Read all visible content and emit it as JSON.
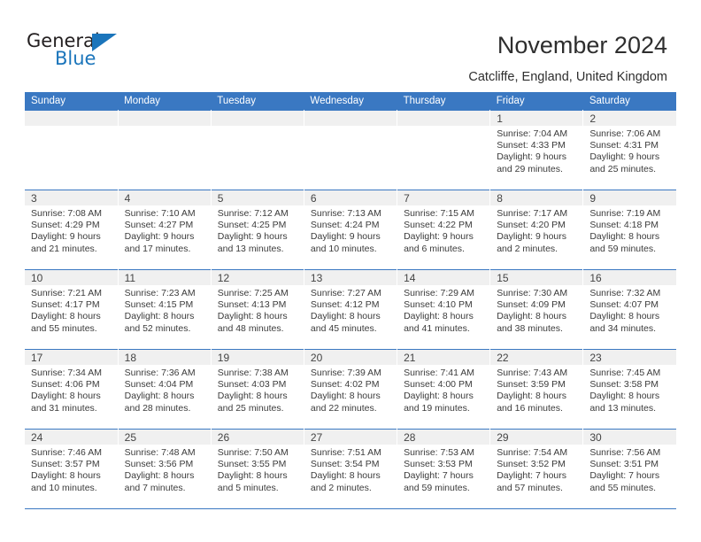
{
  "brand": {
    "name_top": "General",
    "name_bottom": "Blue",
    "accent_color": "#1b75bb"
  },
  "header": {
    "title": "November 2024",
    "subtitle": "Catcliffe, England, United Kingdom"
  },
  "theme": {
    "header_blue": "#3a78c2",
    "daynum_background": "#f0f0f0",
    "text_color": "#3b3b3b"
  },
  "calendar": {
    "weekday_headers": [
      "Sunday",
      "Monday",
      "Tuesday",
      "Wednesday",
      "Thursday",
      "Friday",
      "Saturday"
    ],
    "weeks": [
      [
        {
          "day": "",
          "empty": true
        },
        {
          "day": "",
          "empty": true
        },
        {
          "day": "",
          "empty": true
        },
        {
          "day": "",
          "empty": true
        },
        {
          "day": "",
          "empty": true
        },
        {
          "day": "1",
          "sunrise": "Sunrise: 7:04 AM",
          "sunset": "Sunset: 4:33 PM",
          "daylight_line1": "Daylight: 9 hours",
          "daylight_line2": "and 29 minutes."
        },
        {
          "day": "2",
          "sunrise": "Sunrise: 7:06 AM",
          "sunset": "Sunset: 4:31 PM",
          "daylight_line1": "Daylight: 9 hours",
          "daylight_line2": "and 25 minutes."
        }
      ],
      [
        {
          "day": "3",
          "sunrise": "Sunrise: 7:08 AM",
          "sunset": "Sunset: 4:29 PM",
          "daylight_line1": "Daylight: 9 hours",
          "daylight_line2": "and 21 minutes."
        },
        {
          "day": "4",
          "sunrise": "Sunrise: 7:10 AM",
          "sunset": "Sunset: 4:27 PM",
          "daylight_line1": "Daylight: 9 hours",
          "daylight_line2": "and 17 minutes."
        },
        {
          "day": "5",
          "sunrise": "Sunrise: 7:12 AM",
          "sunset": "Sunset: 4:25 PM",
          "daylight_line1": "Daylight: 9 hours",
          "daylight_line2": "and 13 minutes."
        },
        {
          "day": "6",
          "sunrise": "Sunrise: 7:13 AM",
          "sunset": "Sunset: 4:24 PM",
          "daylight_line1": "Daylight: 9 hours",
          "daylight_line2": "and 10 minutes."
        },
        {
          "day": "7",
          "sunrise": "Sunrise: 7:15 AM",
          "sunset": "Sunset: 4:22 PM",
          "daylight_line1": "Daylight: 9 hours",
          "daylight_line2": "and 6 minutes."
        },
        {
          "day": "8",
          "sunrise": "Sunrise: 7:17 AM",
          "sunset": "Sunset: 4:20 PM",
          "daylight_line1": "Daylight: 9 hours",
          "daylight_line2": "and 2 minutes."
        },
        {
          "day": "9",
          "sunrise": "Sunrise: 7:19 AM",
          "sunset": "Sunset: 4:18 PM",
          "daylight_line1": "Daylight: 8 hours",
          "daylight_line2": "and 59 minutes."
        }
      ],
      [
        {
          "day": "10",
          "sunrise": "Sunrise: 7:21 AM",
          "sunset": "Sunset: 4:17 PM",
          "daylight_line1": "Daylight: 8 hours",
          "daylight_line2": "and 55 minutes."
        },
        {
          "day": "11",
          "sunrise": "Sunrise: 7:23 AM",
          "sunset": "Sunset: 4:15 PM",
          "daylight_line1": "Daylight: 8 hours",
          "daylight_line2": "and 52 minutes."
        },
        {
          "day": "12",
          "sunrise": "Sunrise: 7:25 AM",
          "sunset": "Sunset: 4:13 PM",
          "daylight_line1": "Daylight: 8 hours",
          "daylight_line2": "and 48 minutes."
        },
        {
          "day": "13",
          "sunrise": "Sunrise: 7:27 AM",
          "sunset": "Sunset: 4:12 PM",
          "daylight_line1": "Daylight: 8 hours",
          "daylight_line2": "and 45 minutes."
        },
        {
          "day": "14",
          "sunrise": "Sunrise: 7:29 AM",
          "sunset": "Sunset: 4:10 PM",
          "daylight_line1": "Daylight: 8 hours",
          "daylight_line2": "and 41 minutes."
        },
        {
          "day": "15",
          "sunrise": "Sunrise: 7:30 AM",
          "sunset": "Sunset: 4:09 PM",
          "daylight_line1": "Daylight: 8 hours",
          "daylight_line2": "and 38 minutes."
        },
        {
          "day": "16",
          "sunrise": "Sunrise: 7:32 AM",
          "sunset": "Sunset: 4:07 PM",
          "daylight_line1": "Daylight: 8 hours",
          "daylight_line2": "and 34 minutes."
        }
      ],
      [
        {
          "day": "17",
          "sunrise": "Sunrise: 7:34 AM",
          "sunset": "Sunset: 4:06 PM",
          "daylight_line1": "Daylight: 8 hours",
          "daylight_line2": "and 31 minutes."
        },
        {
          "day": "18",
          "sunrise": "Sunrise: 7:36 AM",
          "sunset": "Sunset: 4:04 PM",
          "daylight_line1": "Daylight: 8 hours",
          "daylight_line2": "and 28 minutes."
        },
        {
          "day": "19",
          "sunrise": "Sunrise: 7:38 AM",
          "sunset": "Sunset: 4:03 PM",
          "daylight_line1": "Daylight: 8 hours",
          "daylight_line2": "and 25 minutes."
        },
        {
          "day": "20",
          "sunrise": "Sunrise: 7:39 AM",
          "sunset": "Sunset: 4:02 PM",
          "daylight_line1": "Daylight: 8 hours",
          "daylight_line2": "and 22 minutes."
        },
        {
          "day": "21",
          "sunrise": "Sunrise: 7:41 AM",
          "sunset": "Sunset: 4:00 PM",
          "daylight_line1": "Daylight: 8 hours",
          "daylight_line2": "and 19 minutes."
        },
        {
          "day": "22",
          "sunrise": "Sunrise: 7:43 AM",
          "sunset": "Sunset: 3:59 PM",
          "daylight_line1": "Daylight: 8 hours",
          "daylight_line2": "and 16 minutes."
        },
        {
          "day": "23",
          "sunrise": "Sunrise: 7:45 AM",
          "sunset": "Sunset: 3:58 PM",
          "daylight_line1": "Daylight: 8 hours",
          "daylight_line2": "and 13 minutes."
        }
      ],
      [
        {
          "day": "24",
          "sunrise": "Sunrise: 7:46 AM",
          "sunset": "Sunset: 3:57 PM",
          "daylight_line1": "Daylight: 8 hours",
          "daylight_line2": "and 10 minutes."
        },
        {
          "day": "25",
          "sunrise": "Sunrise: 7:48 AM",
          "sunset": "Sunset: 3:56 PM",
          "daylight_line1": "Daylight: 8 hours",
          "daylight_line2": "and 7 minutes."
        },
        {
          "day": "26",
          "sunrise": "Sunrise: 7:50 AM",
          "sunset": "Sunset: 3:55 PM",
          "daylight_line1": "Daylight: 8 hours",
          "daylight_line2": "and 5 minutes."
        },
        {
          "day": "27",
          "sunrise": "Sunrise: 7:51 AM",
          "sunset": "Sunset: 3:54 PM",
          "daylight_line1": "Daylight: 8 hours",
          "daylight_line2": "and 2 minutes."
        },
        {
          "day": "28",
          "sunrise": "Sunrise: 7:53 AM",
          "sunset": "Sunset: 3:53 PM",
          "daylight_line1": "Daylight: 7 hours",
          "daylight_line2": "and 59 minutes."
        },
        {
          "day": "29",
          "sunrise": "Sunrise: 7:54 AM",
          "sunset": "Sunset: 3:52 PM",
          "daylight_line1": "Daylight: 7 hours",
          "daylight_line2": "and 57 minutes."
        },
        {
          "day": "30",
          "sunrise": "Sunrise: 7:56 AM",
          "sunset": "Sunset: 3:51 PM",
          "daylight_line1": "Daylight: 7 hours",
          "daylight_line2": "and 55 minutes."
        }
      ]
    ]
  }
}
